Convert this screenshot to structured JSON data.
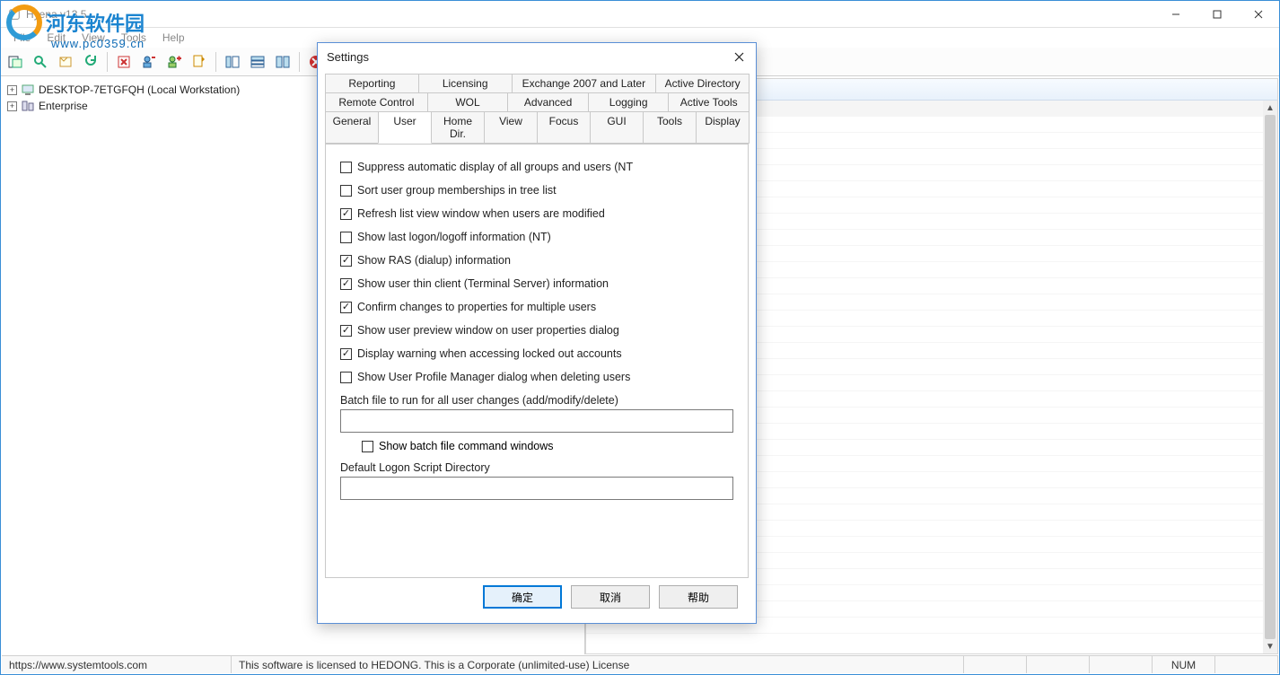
{
  "window": {
    "title": "Hyena v13.5"
  },
  "menu": [
    "File",
    "Edit",
    "View",
    "Tools",
    "Help"
  ],
  "watermark": {
    "big": "河东软件园",
    "small": "www.pc0359.cn"
  },
  "tree": {
    "node1": "DESKTOP-7ETGFQH (Local Workstation)",
    "node2": "Enterprise"
  },
  "statusbar": {
    "url": "https://www.systemtools.com",
    "license": "This software is licensed to HEDONG. This is a Corporate (unlimited-use) License",
    "indicator": "NUM"
  },
  "dialog": {
    "title": "Settings",
    "tabs_row1": [
      "Reporting",
      "Licensing",
      "Exchange 2007 and Later",
      "Active Directory"
    ],
    "tabs_row2": [
      "Remote Control",
      "WOL",
      "Advanced",
      "Logging",
      "Active Tools"
    ],
    "tabs_row3": [
      "General",
      "User",
      "Home Dir.",
      "View",
      "Focus",
      "GUI",
      "Tools",
      "Display"
    ],
    "active_tab": "User",
    "options": [
      {
        "label": "Suppress automatic display of all groups and users (NT",
        "checked": false
      },
      {
        "label": "Sort user group memberships in tree list",
        "checked": false
      },
      {
        "label": "Refresh list view window when users are modified",
        "checked": true
      },
      {
        "label": "Show last logon/logoff information (NT)",
        "checked": false
      },
      {
        "label": "Show RAS (dialup) information",
        "checked": true
      },
      {
        "label": "Show user thin client (Terminal Server) information",
        "checked": true
      },
      {
        "label": "Confirm changes to properties for multiple users",
        "checked": true
      },
      {
        "label": "Show user preview window on user properties dialog",
        "checked": true
      },
      {
        "label": "Display warning when accessing locked out accounts",
        "checked": true
      },
      {
        "label": "Show User Profile Manager dialog when deleting users",
        "checked": false
      }
    ],
    "batch_label": "Batch file to run for all user changes (add/modify/delete)",
    "batch_value": "",
    "batch_sub": {
      "label": "Show batch file command windows",
      "checked": false
    },
    "logon_label": "Default Logon Script Directory",
    "logon_value": "",
    "buttons": {
      "ok": "确定",
      "cancel": "取消",
      "help": "帮助"
    }
  }
}
